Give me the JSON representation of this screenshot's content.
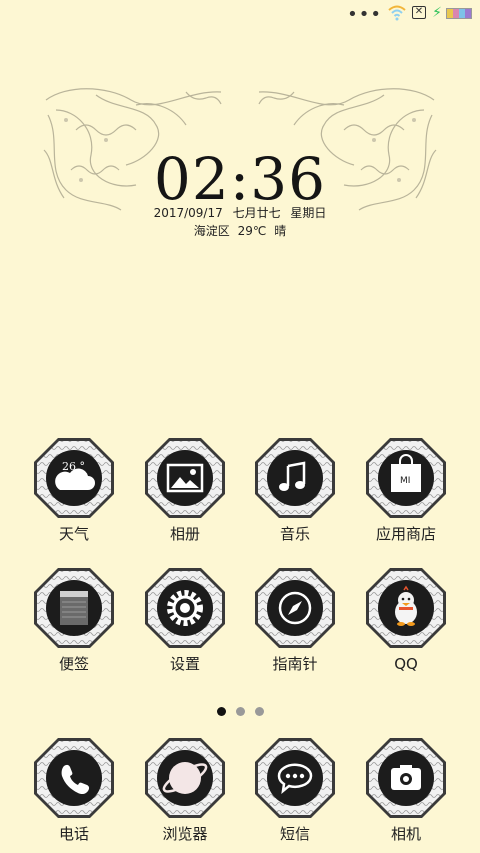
{
  "status_bar": {
    "icons": [
      "more-dots-icon",
      "wifi-icon",
      "sim-x-icon",
      "charging-icon",
      "battery-icon"
    ],
    "battery_colors": [
      "#e8c84f",
      "#d986b0",
      "#7dc2e8",
      "#9a7ad0"
    ]
  },
  "clock": {
    "time": "02:36",
    "date": "2017/09/17",
    "lunar_date": "七月廿七",
    "weekday": "星期日",
    "location": "海淀区",
    "temperature": "29℃",
    "condition": "晴"
  },
  "apps": [
    {
      "label": "天气",
      "icon": "weather-icon",
      "badge": "26 °"
    },
    {
      "label": "相册",
      "icon": "gallery-icon"
    },
    {
      "label": "音乐",
      "icon": "music-icon"
    },
    {
      "label": "应用商店",
      "icon": "app-store-icon",
      "badge": "MI"
    },
    {
      "label": "便签",
      "icon": "notes-icon"
    },
    {
      "label": "设置",
      "icon": "settings-icon"
    },
    {
      "label": "指南针",
      "icon": "compass-icon"
    },
    {
      "label": "QQ",
      "icon": "qq-icon"
    }
  ],
  "page_indicator": {
    "pages": 3,
    "active": 1
  },
  "dock": [
    {
      "label": "电话",
      "icon": "phone-icon"
    },
    {
      "label": "浏览器",
      "icon": "browser-icon"
    },
    {
      "label": "短信",
      "icon": "messages-icon"
    },
    {
      "label": "相机",
      "icon": "camera-icon"
    }
  ],
  "colors": {
    "background": "#fdf7d3",
    "icon_dark": "#1c1c1c",
    "frame": "#e9e9e9",
    "accent_green": "#2ec05a"
  }
}
